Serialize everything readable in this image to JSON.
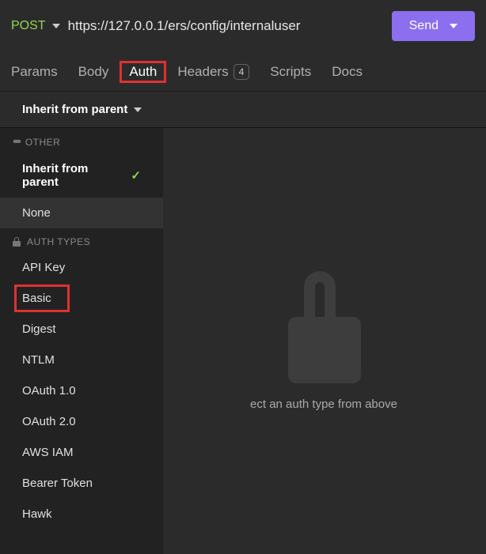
{
  "request": {
    "method": "POST",
    "url": "https://127.0.0.1/ers/config/internaluser",
    "send_label": "Send"
  },
  "tabs": {
    "params": "Params",
    "body": "Body",
    "auth": "Auth",
    "headers": "Headers",
    "headers_count": "4",
    "scripts": "Scripts",
    "docs": "Docs"
  },
  "auth": {
    "selector_label": "Inherit from parent",
    "sections": {
      "other_label": "OTHER",
      "types_label": "AUTH TYPES",
      "inherit": "Inherit from parent",
      "none": "None",
      "api_key": "API Key",
      "basic": "Basic",
      "digest": "Digest",
      "ntlm": "NTLM",
      "oauth1": "OAuth 1.0",
      "oauth2": "OAuth 2.0",
      "aws_iam": "AWS IAM",
      "bearer": "Bearer Token",
      "hawk": "Hawk"
    },
    "placeholder": "ect an auth type from above"
  }
}
